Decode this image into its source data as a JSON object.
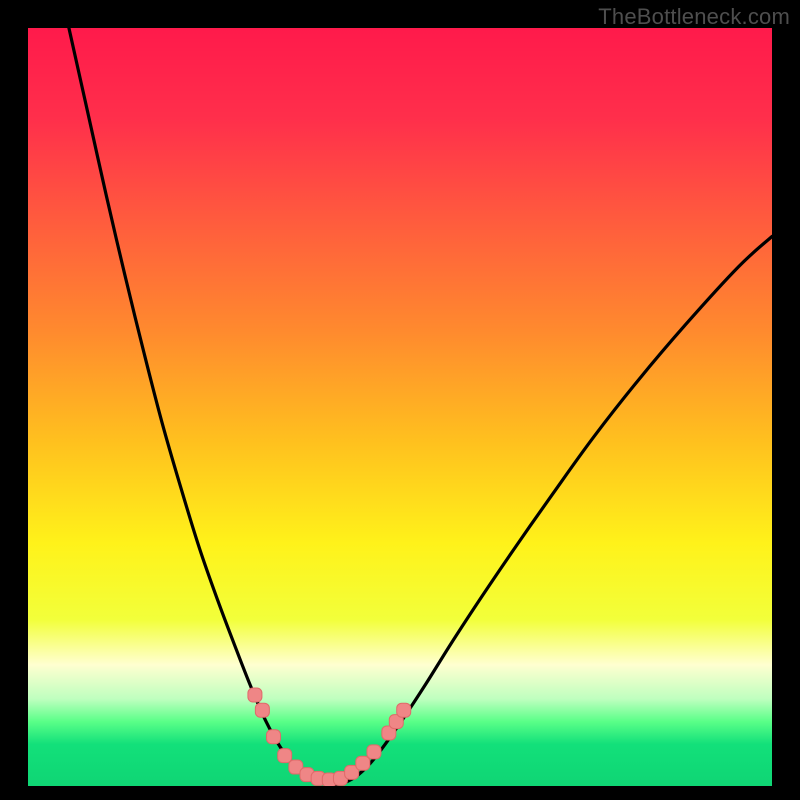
{
  "watermark": "TheBottleneck.com",
  "chart_data": {
    "type": "line",
    "title": "",
    "xlabel": "",
    "ylabel": "",
    "xlim": [
      0,
      100
    ],
    "ylim": [
      0,
      100
    ],
    "grid": false,
    "legend": false,
    "background_gradient": {
      "stops": [
        {
          "pos": 0.0,
          "color": "#ff1a4b"
        },
        {
          "pos": 0.12,
          "color": "#ff2f4b"
        },
        {
          "pos": 0.25,
          "color": "#ff5a3e"
        },
        {
          "pos": 0.4,
          "color": "#ff8a2e"
        },
        {
          "pos": 0.55,
          "color": "#ffc21e"
        },
        {
          "pos": 0.68,
          "color": "#fff21a"
        },
        {
          "pos": 0.78,
          "color": "#f2ff3a"
        },
        {
          "pos": 0.84,
          "color": "#ffffd0"
        },
        {
          "pos": 0.885,
          "color": "#bfffbf"
        },
        {
          "pos": 0.915,
          "color": "#5aff88"
        },
        {
          "pos": 0.945,
          "color": "#12e07a"
        },
        {
          "pos": 1.0,
          "color": "#0fd574"
        }
      ]
    },
    "series": [
      {
        "name": "bottleneck-curve",
        "color": "#000000",
        "points": [
          {
            "x": 5.5,
            "y": 100.0
          },
          {
            "x": 8.0,
            "y": 89.0
          },
          {
            "x": 10.5,
            "y": 78.0
          },
          {
            "x": 13.0,
            "y": 67.5
          },
          {
            "x": 15.5,
            "y": 57.5
          },
          {
            "x": 18.0,
            "y": 48.0
          },
          {
            "x": 20.5,
            "y": 39.5
          },
          {
            "x": 23.0,
            "y": 31.5
          },
          {
            "x": 25.5,
            "y": 24.5
          },
          {
            "x": 28.0,
            "y": 18.0
          },
          {
            "x": 30.0,
            "y": 13.0
          },
          {
            "x": 32.0,
            "y": 8.5
          },
          {
            "x": 34.0,
            "y": 5.0
          },
          {
            "x": 36.0,
            "y": 2.5
          },
          {
            "x": 38.0,
            "y": 1.0
          },
          {
            "x": 40.0,
            "y": 0.3
          },
          {
            "x": 42.0,
            "y": 0.3
          },
          {
            "x": 44.0,
            "y": 1.2
          },
          {
            "x": 46.0,
            "y": 3.0
          },
          {
            "x": 48.0,
            "y": 5.5
          },
          {
            "x": 50.5,
            "y": 9.0
          },
          {
            "x": 53.5,
            "y": 13.5
          },
          {
            "x": 57.0,
            "y": 19.0
          },
          {
            "x": 61.0,
            "y": 25.0
          },
          {
            "x": 65.5,
            "y": 31.5
          },
          {
            "x": 70.5,
            "y": 38.5
          },
          {
            "x": 76.0,
            "y": 46.0
          },
          {
            "x": 82.0,
            "y": 53.5
          },
          {
            "x": 88.5,
            "y": 61.0
          },
          {
            "x": 95.5,
            "y": 68.5
          },
          {
            "x": 100.0,
            "y": 72.5
          }
        ]
      }
    ],
    "markers": {
      "name": "overlay-dots",
      "shape": "rounded-rect",
      "fill": "#ef8686",
      "stroke": "#e06a6a",
      "points": [
        {
          "x": 30.5,
          "y": 12.0
        },
        {
          "x": 31.5,
          "y": 10.0
        },
        {
          "x": 33.0,
          "y": 6.5
        },
        {
          "x": 34.5,
          "y": 4.0
        },
        {
          "x": 36.0,
          "y": 2.5
        },
        {
          "x": 37.5,
          "y": 1.5
        },
        {
          "x": 39.0,
          "y": 1.0
        },
        {
          "x": 40.5,
          "y": 0.8
        },
        {
          "x": 42.0,
          "y": 1.0
        },
        {
          "x": 43.5,
          "y": 1.8
        },
        {
          "x": 45.0,
          "y": 3.0
        },
        {
          "x": 46.5,
          "y": 4.5
        },
        {
          "x": 48.5,
          "y": 7.0
        },
        {
          "x": 49.5,
          "y": 8.5
        },
        {
          "x": 50.5,
          "y": 10.0
        }
      ]
    }
  }
}
